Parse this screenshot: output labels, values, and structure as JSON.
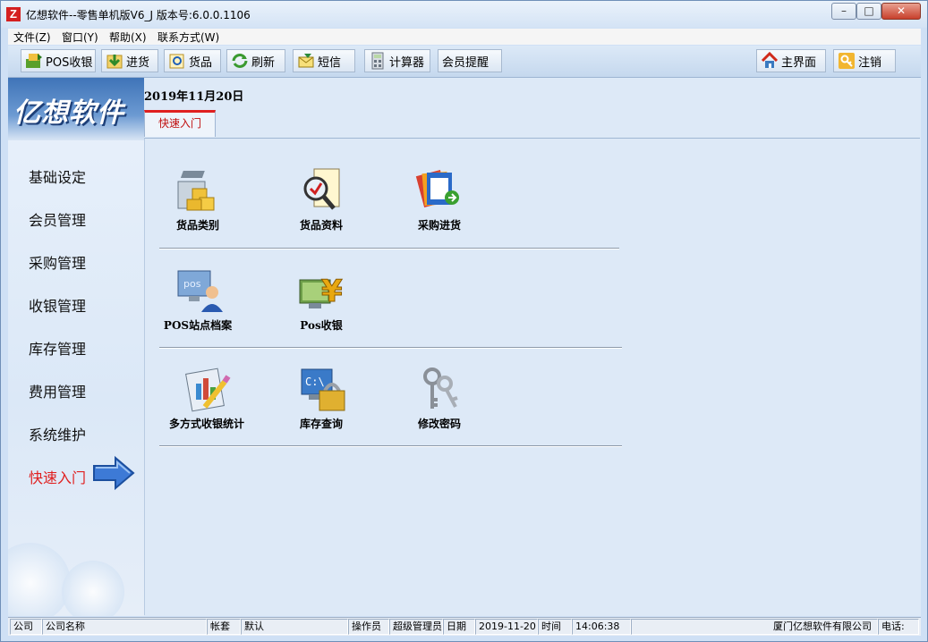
{
  "window": {
    "title": "亿想软件--零售单机版V6_J  版本号:6.0.0.1106",
    "logo_letter": "Z",
    "minimize_icon": "minimize-icon",
    "maximize_icon": "maximize-icon",
    "close_icon": "close-icon"
  },
  "menu": [
    "文件(Z)",
    "窗口(Y)",
    "帮助(X)",
    "联系方式(W)"
  ],
  "toolbar": {
    "pos": "POS收银",
    "purchase": "进货",
    "goods": "货品",
    "refresh": "刷新",
    "sms": "短信",
    "calculator": "计算器",
    "member_reminder": "会员提醒",
    "home": "主界面",
    "logout": "注销"
  },
  "sidebar": {
    "logo": "亿想软件",
    "items": [
      "基础设定",
      "会员管理",
      "采购管理",
      "收银管理",
      "库存管理",
      "费用管理",
      "系统维护",
      "快速入门"
    ],
    "active_index": 7
  },
  "main": {
    "date": "2019年11月20日",
    "tab": "快速入门",
    "quick": {
      "goods_category": "货品类别",
      "goods_info": "货品资料",
      "purchase_in": "采购进货",
      "pos_station": "POS站点档案",
      "pos_cashier": "Pos收银",
      "cash_stats": "多方式收银统计",
      "stock_query": "库存查询",
      "change_password": "修改密码"
    }
  },
  "status": {
    "company_label": "公司",
    "company_value": "公司名称",
    "account_label": "帐套",
    "account_value": "默认",
    "operator_label": "操作员",
    "operator_value": "超级管理员",
    "date_label": "日期",
    "date_value": "2019-11-20",
    "time_label": "时间",
    "time_value": "14:06:38",
    "vendor": "厦门亿想软件有限公司",
    "phone_label": "电话:"
  },
  "colors": {
    "active": "#e02020",
    "accent": "#3f74b8"
  }
}
